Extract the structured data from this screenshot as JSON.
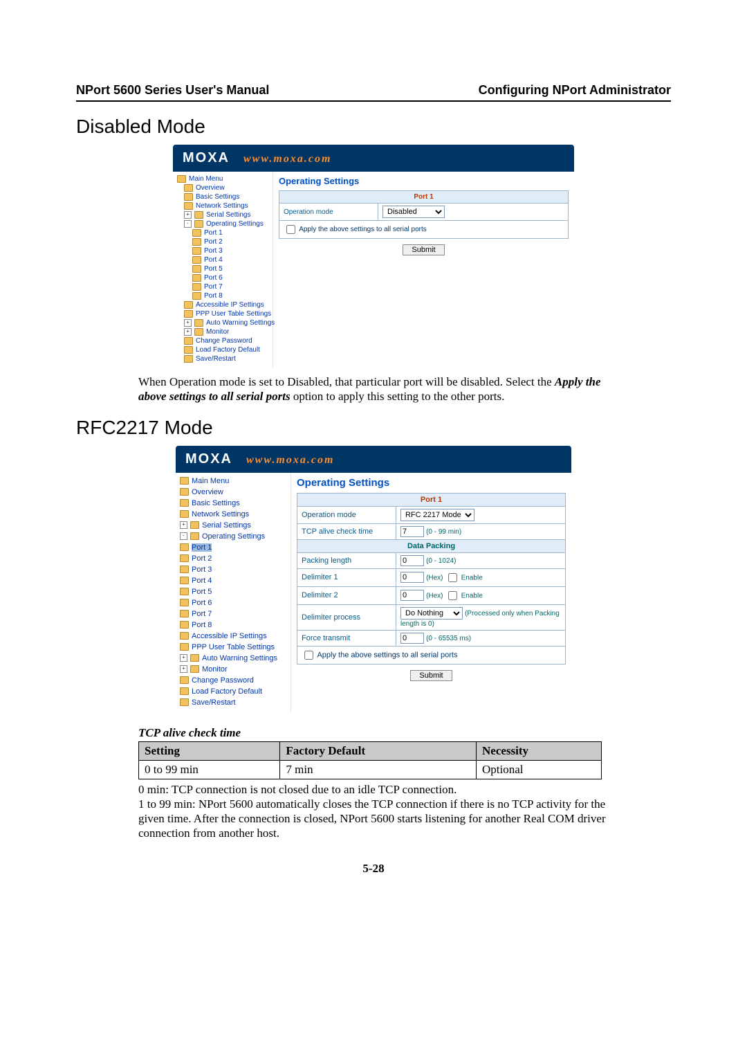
{
  "header": {
    "left": "NPort 5600 Series User's Manual",
    "right": "Configuring NPort Administrator"
  },
  "sections": {
    "disabled": "Disabled Mode",
    "rfc": "RFC2217 Mode"
  },
  "moxa": {
    "logo": "MOXA",
    "url": "www.moxa.com",
    "title": "Operating Settings"
  },
  "tree": {
    "main": "Main Menu",
    "overview": "Overview",
    "basic": "Basic Settings",
    "network": "Network Settings",
    "serial": "Serial Settings",
    "oper": "Operating Settings",
    "port1": "Port 1",
    "port2": "Port 2",
    "port3": "Port 3",
    "port4": "Port 4",
    "port5": "Port 5",
    "port6": "Port 6",
    "port7": "Port 7",
    "port8": "Port 8",
    "accessip": "Accessible IP Settings",
    "ppp": "PPP User Table Settings",
    "autowarn": "Auto Warning Settings",
    "monitor": "Monitor",
    "chpwd": "Change Password",
    "loaddef": "Load Factory Default",
    "save": "Save/Restart"
  },
  "shot1": {
    "port_header": "Port 1",
    "opmode_label": "Operation mode",
    "opmode_value": "Disabled",
    "applyall": "Apply the above settings to all serial ports",
    "submit": "Submit"
  },
  "shot2": {
    "port_header": "Port 1",
    "opmode_label": "Operation mode",
    "opmode_value": "RFC 2217 Mode",
    "tcpalive_label": "TCP alive check time",
    "tcpalive_value": "7",
    "tcpalive_hint": "(0 - 99 min)",
    "datapacking": "Data Packing",
    "packlen_label": "Packing length",
    "packlen_value": "0",
    "packlen_hint": "(0 - 1024)",
    "delim1_label": "Delimiter 1",
    "delim1_value": "0",
    "delim2_label": "Delimiter 2",
    "delim2_value": "0",
    "hex_enable": "(Hex)  Enable",
    "delimproc_label": "Delimiter process",
    "delimproc_value": "Do Nothing",
    "delimproc_hint": "(Processed only when Packing length is 0)",
    "forcetx_label": "Force transmit",
    "forcetx_value": "0",
    "forcetx_hint": "(0 - 65535 ms)",
    "applyall": "Apply the above settings to all serial ports",
    "submit": "Submit"
  },
  "para1a": "When Operation mode is set to Disabled, that particular port will be disabled. Select the ",
  "para1b": "Apply the above settings to all serial ports",
  "para1c": " option to apply this setting to the other ports.",
  "tablecap": "TCP alive check time",
  "spec": {
    "h1": "Setting",
    "h2": "Factory Default",
    "h3": "Necessity",
    "c1": "0 to 99 min",
    "c2": "7 min",
    "c3": "Optional"
  },
  "para2": "0 min: TCP connection is not closed due to an idle TCP connection.",
  "para3": "1 to 99 min: NPort 5600 automatically closes the TCP connection if there is no TCP activity for the given time. After the connection is closed, NPort 5600 starts listening for another Real COM driver connection from another host.",
  "pagenum": "5-28"
}
